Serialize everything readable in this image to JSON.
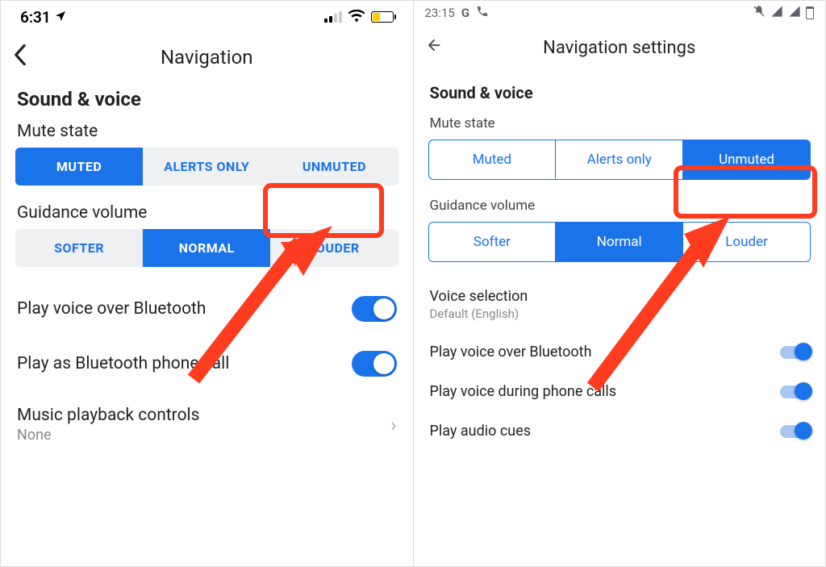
{
  "ios": {
    "status": {
      "time": "6:31"
    },
    "navbar": {
      "title": "Navigation"
    },
    "section": "Sound & voice",
    "mute": {
      "label": "Mute state",
      "options": [
        "MUTED",
        "ALERTS ONLY",
        "UNMUTED"
      ],
      "selected": 0
    },
    "guidance": {
      "label": "Guidance volume",
      "options": [
        "SOFTER",
        "NORMAL",
        "LOUDER"
      ],
      "selected": 1
    },
    "rows": {
      "bluetooth": "Play voice over Bluetooth",
      "phonecall": "Play as Bluetooth phone call",
      "music": "Music playback controls",
      "music_sub": "None"
    }
  },
  "android": {
    "status": {
      "time": "23:15"
    },
    "navbar": {
      "title": "Navigation settings"
    },
    "section": "Sound & voice",
    "mute": {
      "label": "Mute state",
      "options": [
        "Muted",
        "Alerts only",
        "Unmuted"
      ],
      "selected": 2
    },
    "guidance": {
      "label": "Guidance volume",
      "options": [
        "Softer",
        "Normal",
        "Louder"
      ],
      "selected": 1
    },
    "voice": {
      "label": "Voice selection",
      "value": "Default (English)"
    },
    "rows": {
      "bluetooth": "Play voice over Bluetooth",
      "calls": "Play voice during phone calls",
      "cues": "Play audio cues"
    }
  },
  "annotation": {
    "color": "#ff3b20"
  }
}
